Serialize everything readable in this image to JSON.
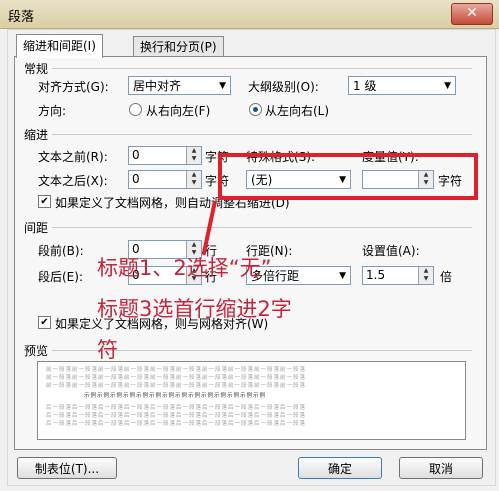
{
  "window": {
    "title": "段落",
    "close": "✕"
  },
  "tabs": [
    "缩进和间距(I)",
    "换行和分页(P)"
  ],
  "general": {
    "section": "常规",
    "align_label": "对齐方式(G):",
    "align_value": "居中对齐",
    "outline_label": "大纲级别(O):",
    "outline_value": "1 级",
    "direction_label": "方向:",
    "rtl": "从右向左(F)",
    "ltr": "从左向右(L)"
  },
  "indent": {
    "section": "缩进",
    "before_label": "文本之前(R):",
    "before_value": "0",
    "before_unit": "字符",
    "special_label": "特殊格式(S):",
    "special_value": "(无)",
    "measure_label": "度量值(Y):",
    "measure_unit": "字符",
    "after_label": "文本之后(X):",
    "after_value": "0",
    "after_unit": "字符",
    "grid_check": "如果定义了文档网格，则自动调整右缩进(D)"
  },
  "spacing": {
    "section": "间距",
    "before_label": "段前(B):",
    "before_value": "0",
    "before_unit": "行",
    "line_label": "行距(N):",
    "setting_label": "设置值(A):",
    "after_label": "段后(E):",
    "after_value": "0",
    "after_unit": "行",
    "line_value": "多倍行距",
    "setting_value": "1.5",
    "setting_unit": "倍",
    "grid_check": "如果定义了文档网格，则与网格对齐(W)"
  },
  "preview": {
    "section": "预览",
    "prev": "前一段落前一段落前一段落前一段落前一段落前一段落前一段落前一段落前一段落前一段落",
    "sample": "示例示例示例示例示例示例示例示例示例示例示例示例示例示例",
    "next": "后一段落后一段落后一段落后一段落后一段落后一段落后一段落后一段落后一段落后一段落"
  },
  "buttons": {
    "tabs": "制表位(T)...",
    "ok": "确定",
    "cancel": "取消"
  },
  "annotation": {
    "line1": "标题1、2选择“无”",
    "line2": "标题3选首行缩进2字",
    "line3": "符",
    "color": "#e0202a"
  }
}
